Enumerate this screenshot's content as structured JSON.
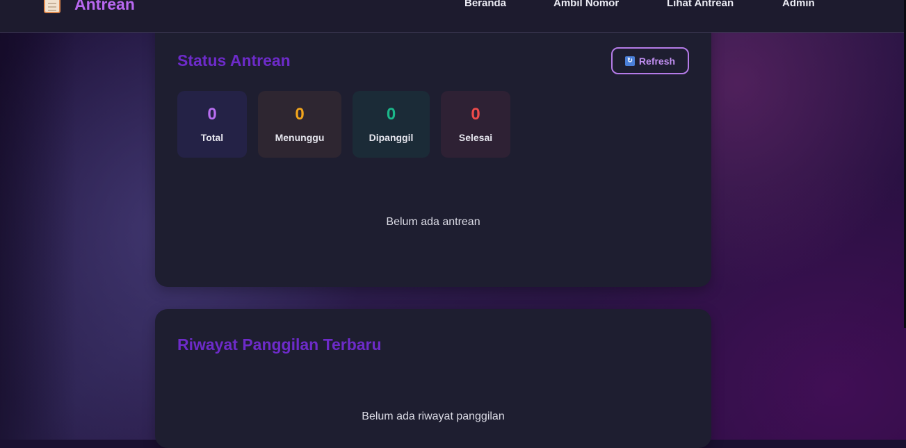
{
  "app": {
    "title": "Antrean"
  },
  "nav": {
    "beranda": "Beranda",
    "ambil_nomor": "Ambil Nomor",
    "lihat_antrean": "Lihat Antrean",
    "admin": "Admin"
  },
  "status": {
    "title": "Status Antrean",
    "refresh_label": "Refresh",
    "stats": [
      {
        "label": "Total",
        "value": "0",
        "color": "#b86ef0",
        "bg": "#242246"
      },
      {
        "label": "Menunggu",
        "value": "0",
        "color": "#f2a51c",
        "bg": "#2e2631"
      },
      {
        "label": "Dipanggil",
        "value": "0",
        "color": "#1bb88a",
        "bg": "#1b2b37"
      },
      {
        "label": "Selesai",
        "value": "0",
        "color": "#ee4b4b",
        "bg": "#2e2134"
      }
    ],
    "empty_message": "Belum ada antrean"
  },
  "history": {
    "title": "Riwayat Panggilan Terbaru",
    "empty_message": "Belum ada riwayat panggilan"
  },
  "colors": {
    "accent": "#b868f0",
    "heading": "#6d2bc9",
    "card_bg": "#1e1e30",
    "navbar_bg": "#1d1b2e"
  }
}
